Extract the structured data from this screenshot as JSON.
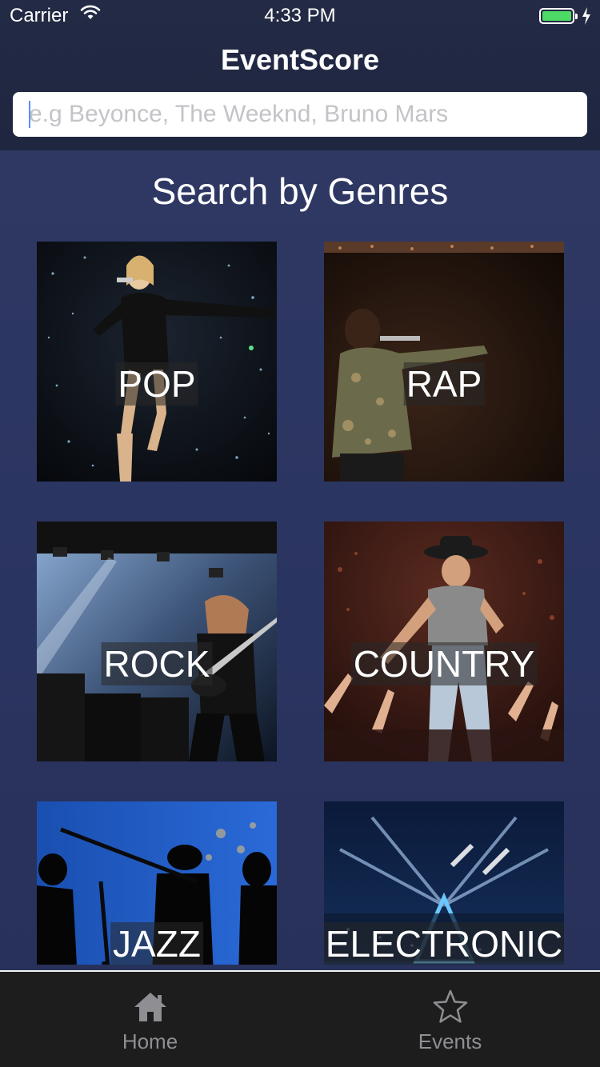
{
  "status_bar": {
    "carrier": "Carrier",
    "time": "4:33 PM",
    "battery_color": "#4cd964"
  },
  "nav": {
    "title": "EventScore"
  },
  "search": {
    "placeholder": "e.g Beyonce, The Weeknd, Bruno Mars",
    "value": ""
  },
  "section": {
    "title": "Search by Genres"
  },
  "genres": [
    {
      "label": "POP",
      "icon": "concert-photo"
    },
    {
      "label": "RAP",
      "icon": "concert-photo"
    },
    {
      "label": "ROCK",
      "icon": "concert-photo"
    },
    {
      "label": "COUNTRY",
      "icon": "concert-photo"
    },
    {
      "label": "JAZZ",
      "icon": "concert-photo"
    },
    {
      "label": "ELECTRONIC",
      "icon": "concert-photo"
    }
  ],
  "tabs": [
    {
      "label": "Home",
      "icon": "home-icon"
    },
    {
      "label": "Events",
      "icon": "star-icon"
    }
  ],
  "colors": {
    "nav_background": "#232a45",
    "content_background": "#2a3460",
    "tabbar_background": "#1d1d1d",
    "tab_inactive": "#8e8e93"
  }
}
